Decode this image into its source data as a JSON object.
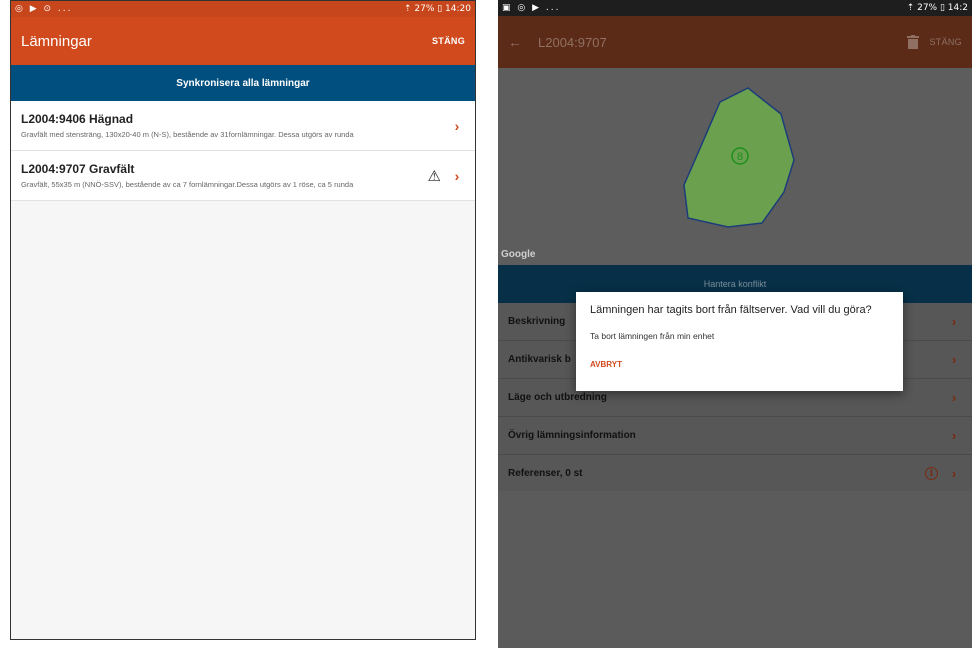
{
  "left": {
    "status": {
      "left_icons": "◎ ▶ ⊙ ...",
      "right_text": "⇡ 27% ▯ 14:20"
    },
    "app_bar": {
      "title": "Lämningar",
      "close_label": "STÄNG"
    },
    "sync_label": "Synkronisera alla lämningar",
    "items": [
      {
        "title": "L2004:9406 Hägnad",
        "desc": "Gravfält med stensträng, 130x20-40 m (N-S), bestående av 31fornlämningar. Dessa utgörs av runda",
        "warning": false
      },
      {
        "title": "L2004:9707 Gravfält",
        "desc": "Gravfält, 55x35 m (NNÖ-SSV), bestående av ca 7 fornlämningar.Dessa utgörs av 1 röse, ca 5 runda",
        "warning": true
      }
    ],
    "chevron": "›",
    "warning_glyph": "⚠"
  },
  "right": {
    "status": {
      "left_icons": "▣ ◎ ▶ ...",
      "right_text": "⇡ 27% ▯ 14:2"
    },
    "app_bar": {
      "back": "←",
      "title": "L2004:9707",
      "close_label": "STÄNG"
    },
    "map": {
      "google_label": "Google",
      "marker": "8"
    },
    "conflict_label": "Hantera konflikt",
    "sections": [
      {
        "label": "Beskrivning",
        "info": false
      },
      {
        "label": "Antikvarisk b",
        "info": false
      },
      {
        "label": "Läge och utbredning",
        "info": false
      },
      {
        "label": "Övrig lämningsinformation",
        "info": false
      },
      {
        "label": "Referenser, 0 st",
        "info": true
      }
    ],
    "info_glyph": "i",
    "dialog": {
      "title": "Lämningen har tagits bort från fältserver. Vad vill du göra?",
      "option": "Ta bort lämningen från min enhet",
      "cancel": "AVBRYT"
    }
  },
  "colors": {
    "primary": "#d04a1d",
    "banner": "#004f7f",
    "polygon": "#6aa04e"
  }
}
